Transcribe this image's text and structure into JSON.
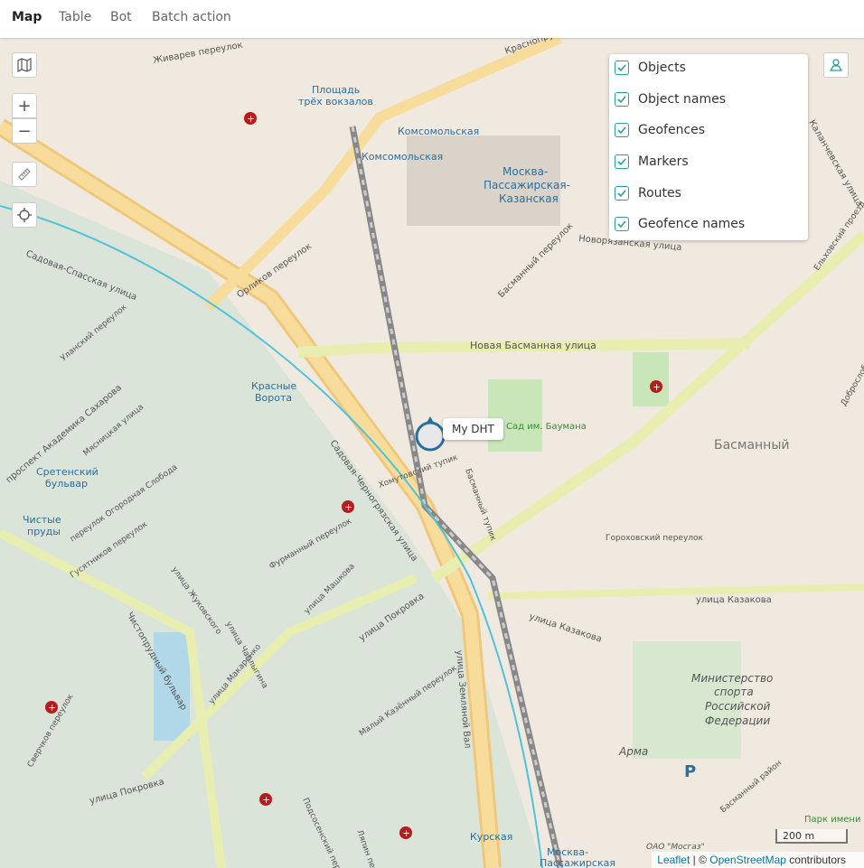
{
  "tabs": [
    {
      "label": "Map",
      "active": true
    },
    {
      "label": "Table",
      "active": false
    },
    {
      "label": "Bot",
      "active": false
    },
    {
      "label": "Batch action",
      "active": false
    }
  ],
  "map": {
    "controls": {
      "layers": "map-icon",
      "zoom_in": "+",
      "zoom_out": "−",
      "ruler": "ruler-icon",
      "locate": "crosshair-icon",
      "user": "user-marker-icon"
    },
    "layers_panel": [
      {
        "label": "Objects",
        "checked": true
      },
      {
        "label": "Object names",
        "checked": true
      },
      {
        "label": "Geofences",
        "checked": true
      },
      {
        "label": "Markers",
        "checked": true
      },
      {
        "label": "Routes",
        "checked": true
      },
      {
        "label": "Geofence names",
        "checked": true
      }
    ],
    "object_marker": {
      "name": "My DHT",
      "color": "#2a6f9e"
    },
    "geofence_color": "#4fc3d9",
    "scale_label": "200 m",
    "attribution": {
      "leaflet": "Leaflet",
      "sep": " | © ",
      "osm": "OpenStreetMap",
      "suffix": " contributors"
    },
    "labels": {
      "zhivarev": "Живарев переулок",
      "ploshchad1": "Площадь",
      "ploshchad2": "трёх вокзалов",
      "komsomolskaya1": "Комсомольская",
      "komsomolskaya2": "Комсомольская",
      "kazan1": "Москва-",
      "kazan2": "Пассажирская-",
      "kazan3": "Казанская",
      "krasnoprudnaya": "Краснопру",
      "kalanchevskaya": "Каланчевская улица",
      "novoryazanskaya": "Новорязанская улица",
      "sadovaya_spasskaya": "Садовая-Спасская улица",
      "orlikov": "Орликов переулок",
      "basmanny_per": "Басманный переулок",
      "novaya_basmannaya": "Новая Басманная улица",
      "krasnye1": "Красные",
      "krasnye2": "Ворота",
      "sadovaya_chernogryazskaya": "Садовая-Черногрязская улица",
      "khomutovsky": "Хомутовский тупик",
      "basmanny_tupik": "Басманный тупик",
      "basmanny_district": "Басманный",
      "garden": "Сад им. Баумана",
      "sakharov": "проспект Академика Сахарова",
      "sretensky1": "Сретенский",
      "sretensky2": "бульвар",
      "chistye1": "Чистые",
      "chistye2": "пруды",
      "chistoprudny": "Чистопрудный бульвар",
      "gorokhovsky": "Гороховский переулок",
      "kazakova": "улица Казакова",
      "kazakova2": "улица Казакова",
      "pokrovka": "улица Покровка",
      "pokrovka2": "улица Покровка",
      "zemlyanoy": "улица Земляной Вал",
      "ministry1": "Министерство",
      "ministry2": "спорта",
      "ministry3": "Российской",
      "ministry4": "Федерации",
      "arma": "Арма",
      "mosgaz": "ОАО \"Мосгаз\"",
      "kurskaya": "Курская",
      "moskva_bottom": "Москва-",
      "passazhirskaya_bottom": "Пассажирская",
      "park_imeni": "Парк имени",
      "lyalin": "Ляпин переулок",
      "dobroslobodskaya": "Доброслободская",
      "yeldoskaya": "Ельховский проезд",
      "furmanny": "Фурманный переулок",
      "mashkova": "улица Машкова",
      "makarenko": "улица Макаренко",
      "chaplygina": "улица Чаплыгина",
      "zhukovskogo": "улица Жуковского",
      "maly_kazenny": "Малый Казённый переулок",
      "podsosensky": "Подсосенский переулок",
      "sverchkov": "Сверчков переулок",
      "ulansky": "Уланский переулок",
      "myasnitskaya": "Мясницкая улица",
      "ogorodnaya": "переулок Огородная Слобода",
      "gusyatnikov": "Гусятников переулок",
      "basmanny_right": "Басманный район",
      "parking": "P"
    }
  }
}
